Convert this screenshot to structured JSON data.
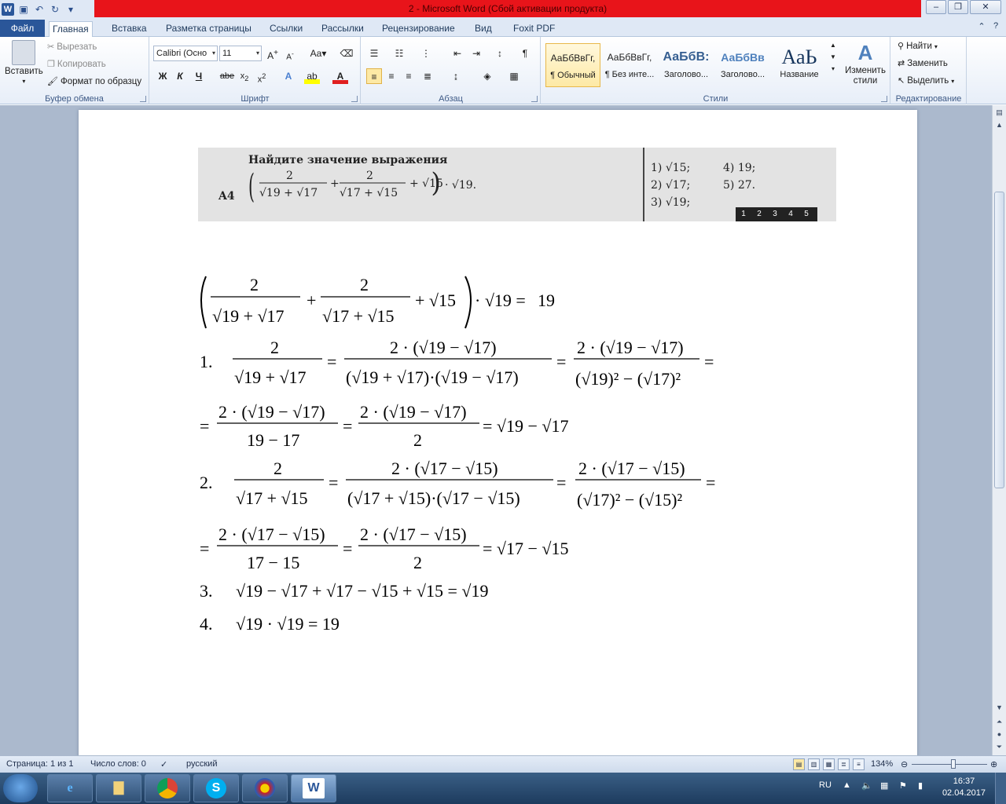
{
  "window": {
    "title": "2  -  Microsoft Word (Сбой активации продукта)",
    "app_icon": "word-icon",
    "minimize": "–",
    "maximize": "❐",
    "close": "✕"
  },
  "tabs": [
    "Файл",
    "Главная",
    "Вставка",
    "Разметка страницы",
    "Ссылки",
    "Рассылки",
    "Рецензирование",
    "Вид",
    "Foxit PDF"
  ],
  "active_tab": "Главная",
  "ribbon": {
    "clipboard": {
      "paste": "Вставить",
      "cut": "Вырезать",
      "copy": "Копировать",
      "format_painter": "Формат по образцу",
      "label": "Буфер обмена"
    },
    "font": {
      "name": "Calibri (Осно",
      "size": "11",
      "label": "Шрифт",
      "bold": "Ж",
      "italic": "К",
      "underline": "Ч",
      "strike": "abe",
      "case": "Aa"
    },
    "paragraph": {
      "label": "Абзац"
    },
    "styles": {
      "label": "Стили",
      "items": [
        {
          "sample": "АаБбВвГг,",
          "name": "¶ Обычный"
        },
        {
          "sample": "АаБбВвГг,",
          "name": "¶ Без инте..."
        },
        {
          "sample": "АаБбВ:",
          "name": "Заголово..."
        },
        {
          "sample": "АаБбВв",
          "name": "Заголово..."
        },
        {
          "sample": "АаЬ",
          "name": "Название"
        }
      ],
      "change_styles": "Изменить стили"
    },
    "editing": {
      "label": "Редактирование",
      "find": "Найти",
      "replace": "Заменить",
      "select": "Выделить"
    }
  },
  "task": {
    "number": "A4",
    "heading": "Найдите значение выражения",
    "options": [
      "1) √15;",
      "2) √17;",
      "3) √19;",
      "4) 19;",
      "5) 27."
    ],
    "answer_cells": [
      "1",
      "2",
      "3",
      "4",
      "5"
    ]
  },
  "solution": {
    "main_equation_result": "19",
    "step_numbers": [
      "1.",
      "2.",
      "3.",
      "4."
    ],
    "step3": "√19 − √17 + √17 − √15 + √15 = √19",
    "step4": "√19 · √19 = 19"
  },
  "status": {
    "page": "Страница: 1 из 1",
    "words": "Число слов: 0",
    "language": "русский",
    "zoom": "134%"
  },
  "taskbar": {
    "language": "RU",
    "time": "16:37",
    "date": "02.04.2017"
  }
}
